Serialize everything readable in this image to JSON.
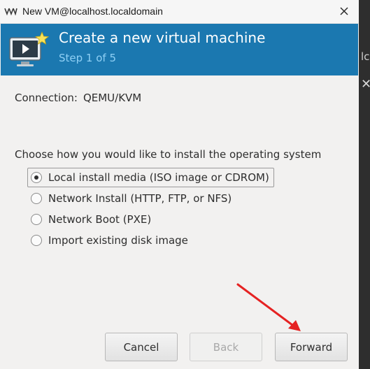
{
  "window": {
    "title": "New VM@localhost.localdomain",
    "close_icon": "close-icon"
  },
  "banner": {
    "heading": "Create a new virtual machine",
    "step": "Step 1 of 5",
    "icon": "vm-monitor-new-icon",
    "bg_color": "#1b78b0"
  },
  "connection": {
    "label": "Connection:",
    "value": "QEMU/KVM"
  },
  "install": {
    "question": "Choose how you would like to install the operating system",
    "options": [
      {
        "label": "Local install media (ISO image or CDROM)",
        "selected": true
      },
      {
        "label": "Network Install (HTTP, FTP, or NFS)",
        "selected": false
      },
      {
        "label": "Network Boot (PXE)",
        "selected": false
      },
      {
        "label": "Import existing disk image",
        "selected": false
      }
    ]
  },
  "buttons": {
    "cancel": "Cancel",
    "back": "Back",
    "forward": "Forward"
  },
  "background": {
    "peek_text": "lc",
    "peek_close": "✕"
  },
  "annotation": {
    "arrow_color": "#e52222"
  }
}
